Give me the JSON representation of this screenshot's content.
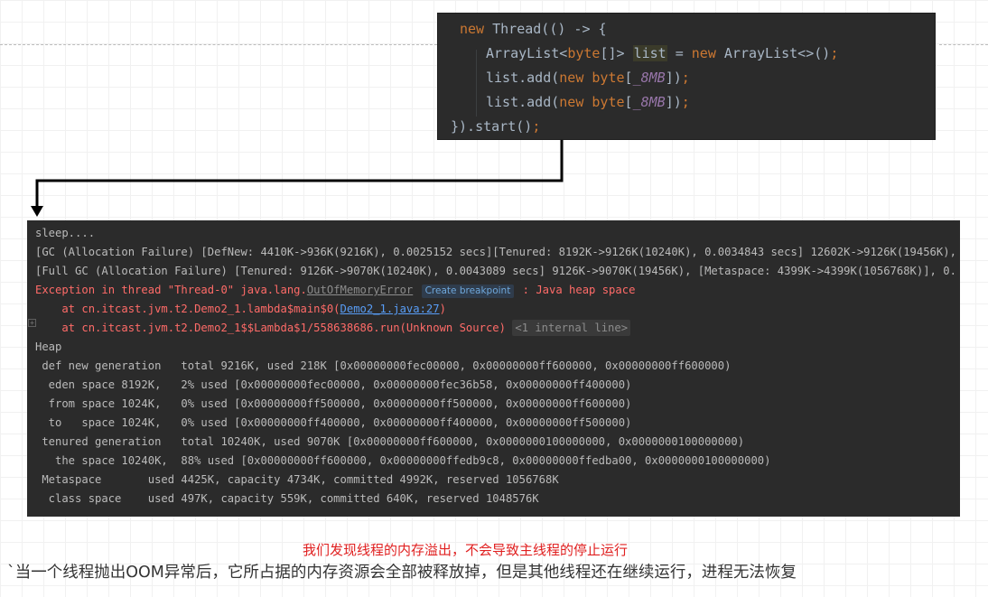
{
  "code": {
    "line1": {
      "kw": "new",
      "rest": " Thread(() -> {"
    },
    "line2": {
      "type": "ArrayList<",
      "kw1": "byte",
      "mid": "[]> ",
      "var": "list",
      "eq": " = ",
      "kw2": "new",
      "rest": " ArrayList<>()",
      "semi": ";"
    },
    "line3": {
      "a": "list.add(",
      "kw1": "new",
      "sp": " ",
      "kw2": "byte",
      "b": "[",
      "num": "_8MB",
      "c": "])",
      "semi": ";"
    },
    "line4": {
      "a": "list.add(",
      "kw1": "new",
      "sp": " ",
      "kw2": "byte",
      "b": "[",
      "num": "_8MB",
      "c": "])",
      "semi": ";"
    },
    "line5": {
      "a": "}).start()",
      "semi": ";"
    }
  },
  "console": {
    "l1": "sleep....",
    "l2": "[GC (Allocation Failure) [DefNew: 4410K->936K(9216K), 0.0025152 secs][Tenured: 8192K->9126K(10240K), 0.0034843 secs] 12602K->9126K(19456K),",
    "l3": "[Full GC (Allocation Failure) [Tenured: 9126K->9070K(10240K), 0.0043089 secs] 9126K->9070K(19456K), [Metaspace: 4399K->4399K(1056768K)], 0.",
    "l4_pre": "Exception in thread \"Thread-0\" java.lang.",
    "l4_link": "OutOfMemoryError",
    "l4_btn": "Create breakpoint",
    "l4_post": " : Java heap space",
    "l5_pre": "    at cn.itcast.jvm.t2.Demo2_1.lambda$main$0(",
    "l5_link": "Demo2_1.java:27",
    "l5_post": ")",
    "l6_pre": "    at cn.itcast.jvm.t2.Demo2_1$$Lambda$1/558638686.run(Unknown Source)",
    "l6_internal": "<1 internal line>",
    "l7": "Heap",
    "l8": " def new generation   total 9216K, used 218K [0x00000000fec00000, 0x00000000ff600000, 0x00000000ff600000)",
    "l9": "  eden space 8192K,   2% used [0x00000000fec00000, 0x00000000fec36b58, 0x00000000ff400000)",
    "l10": "  from space 1024K,   0% used [0x00000000ff500000, 0x00000000ff500000, 0x00000000ff600000)",
    "l11": "  to   space 1024K,   0% used [0x00000000ff400000, 0x00000000ff400000, 0x00000000ff500000)",
    "l12": " tenured generation   total 10240K, used 9070K [0x00000000ff600000, 0x0000000100000000, 0x0000000100000000)",
    "l13": "   the space 10240K,  88% used [0x00000000ff600000, 0x00000000ffedb9c8, 0x00000000ffedba00, 0x0000000100000000)",
    "l14": " Metaspace       used 4425K, capacity 4734K, committed 4992K, reserved 1056768K",
    "l15": "  class space    used 497K, capacity 559K, committed 640K, reserved 1048576K"
  },
  "captions": {
    "red": "我们发现线程的内存溢出，不会导致主线程的停止运行",
    "main": "`当一个线程抛出OOM异常后，它所占据的内存资源会全部被释放掉，但是其他线程还在继续运行，进程无法恢复"
  },
  "colors": {
    "panel_bg": "#2b2b2b",
    "keyword": "#cc7832",
    "number": "#9876aa",
    "error": "#ff6b68",
    "link": "#589df6",
    "caption_red": "#e02020"
  }
}
